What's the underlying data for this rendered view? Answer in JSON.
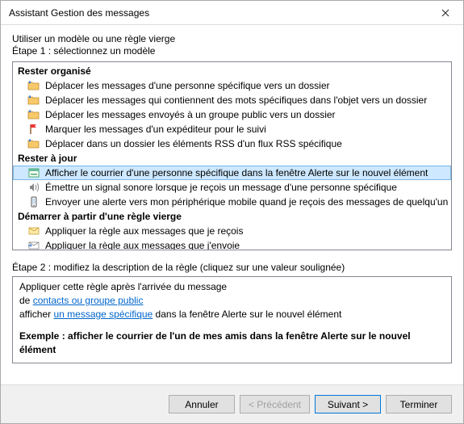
{
  "window": {
    "title": "Assistant Gestion des messages"
  },
  "intro": {
    "line1": "Utiliser un modèle ou une règle vierge",
    "line2": "Étape 1 : sélectionnez un modèle"
  },
  "templates": {
    "groups": [
      {
        "header": "Rester organisé",
        "items": [
          {
            "icon": "folder-move",
            "label": "Déplacer les messages d'une personne spécifique vers un dossier",
            "selected": false
          },
          {
            "icon": "folder-move",
            "label": "Déplacer les messages qui contiennent des mots spécifiques dans l'objet vers un dossier",
            "selected": false
          },
          {
            "icon": "folder-move",
            "label": "Déplacer les messages envoyés à un groupe public vers un dossier",
            "selected": false
          },
          {
            "icon": "flag",
            "label": "Marquer les messages d'un expéditeur pour le suivi",
            "selected": false
          },
          {
            "icon": "folder-move",
            "label": "Déplacer dans un dossier les éléments RSS d'un flux RSS spécifique",
            "selected": false
          }
        ]
      },
      {
        "header": "Rester à jour",
        "items": [
          {
            "icon": "alert-window",
            "label": "Afficher le courrier d'une personne spécifique dans la fenêtre Alerte sur le nouvel élément",
            "selected": true
          },
          {
            "icon": "sound",
            "label": "Émettre un signal sonore lorsque je reçois un message d'une personne spécifique",
            "selected": false
          },
          {
            "icon": "mobile",
            "label": "Envoyer une alerte vers mon périphérique mobile quand je reçois des messages de quelqu'un",
            "selected": false
          }
        ]
      },
      {
        "header": "Démarrer à partir d'une règle vierge",
        "items": [
          {
            "icon": "mail-in",
            "label": "Appliquer la règle aux messages que je reçois",
            "selected": false
          },
          {
            "icon": "mail-out",
            "label": "Appliquer la règle aux messages que j'envoie",
            "selected": false
          }
        ]
      }
    ]
  },
  "step2": {
    "label": "Étape 2 : modifiez la description de la règle (cliquez sur une valeur soulignée)",
    "line1": "Appliquer cette règle après l'arrivée du message",
    "line2_prefix": "de ",
    "line2_link": "contacts ou groupe public",
    "line3_prefix": "afficher ",
    "line3_link": "un message spécifique",
    "line3_suffix": " dans la fenêtre Alerte sur le nouvel élément",
    "example": "Exemple : afficher le courrier de l'un de mes amis dans la fenêtre Alerte sur le nouvel élément"
  },
  "buttons": {
    "cancel": "Annuler",
    "back": "< Précédent",
    "next": "Suivant >",
    "finish": "Terminer"
  },
  "icons": {
    "folder-move": "folder-move-icon",
    "flag": "flag-icon",
    "alert-window": "alert-window-icon",
    "sound": "sound-icon",
    "mobile": "mobile-icon",
    "mail-in": "mail-in-icon",
    "mail-out": "mail-out-icon"
  }
}
